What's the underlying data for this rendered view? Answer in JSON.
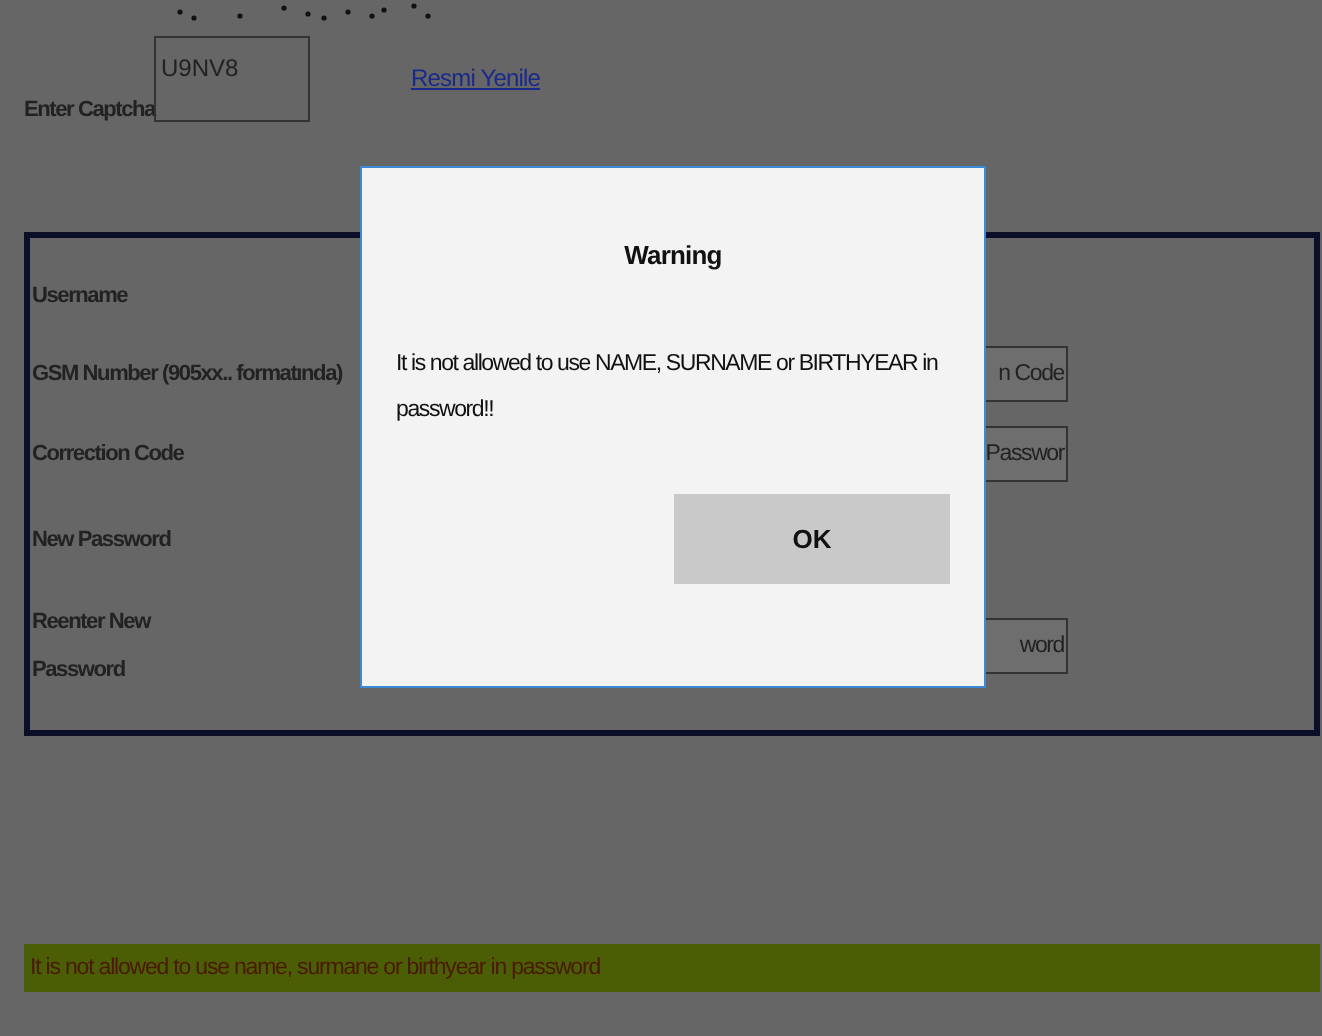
{
  "captcha": {
    "label": "Enter Captcha",
    "value": "U9NV8",
    "refresh_link": "Resmi Yenile"
  },
  "form": {
    "rows": [
      {
        "label": "Username"
      },
      {
        "label": "GSM Number (905xx.. formatında)",
        "button": "n Code"
      },
      {
        "label": "Correction Code",
        "button": "Passwor"
      },
      {
        "label": "New Password"
      },
      {
        "label": "Reenter New Password",
        "button": "word"
      }
    ]
  },
  "dialog": {
    "title": "Warning",
    "message": "It is not allowed to use NAME, SURNAME or BIRTHYEAR in password!!",
    "button": "OK"
  },
  "status_bar": {
    "message": "It is not allowed to use name, surmane or birthyear in password"
  }
}
